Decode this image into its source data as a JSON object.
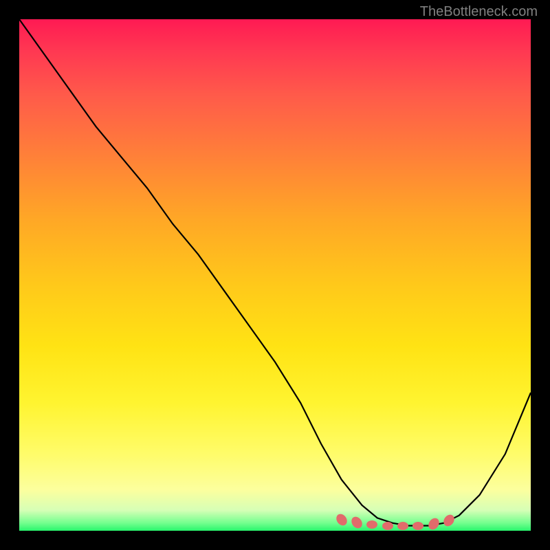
{
  "attribution": "TheBottleneck.com",
  "chart_data": {
    "type": "line",
    "title": "",
    "xlabel": "",
    "ylabel": "",
    "xlim": [
      0,
      100
    ],
    "ylim": [
      0,
      100
    ],
    "series": [
      {
        "name": "bottleneck-curve",
        "x": [
          0,
          5,
          10,
          15,
          20,
          25,
          30,
          35,
          40,
          45,
          50,
          55,
          59,
          63,
          67,
          70,
          73,
          76,
          80,
          83,
          86,
          90,
          95,
          100
        ],
        "values": [
          100,
          93,
          86,
          79,
          73,
          67,
          60,
          54,
          47,
          40,
          33,
          25,
          17,
          10,
          5,
          2.5,
          1.5,
          1,
          1,
          1.5,
          3,
          7,
          15,
          27
        ]
      }
    ],
    "markers": {
      "name": "optimal-range",
      "x": [
        63,
        66,
        69,
        72,
        75,
        78,
        81,
        84
      ],
      "values": [
        2.2,
        1.6,
        1.2,
        1.0,
        1.0,
        1.0,
        1.3,
        2.0
      ]
    },
    "gradient_stops": [
      {
        "pos": 0.0,
        "color": "#ff1a53"
      },
      {
        "pos": 0.5,
        "color": "#ffc91a"
      },
      {
        "pos": 0.92,
        "color": "#fcff9e"
      },
      {
        "pos": 1.0,
        "color": "#28f56c"
      }
    ]
  }
}
